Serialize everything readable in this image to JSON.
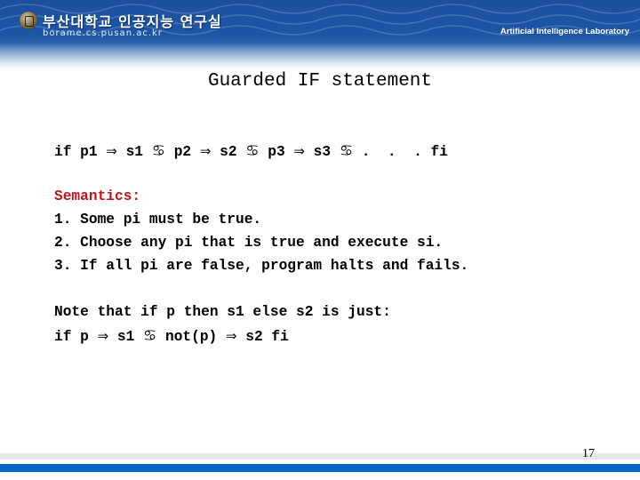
{
  "header": {
    "university_name": "부산대학교 인공지능 연구실",
    "url": "borame.cs.pusan.ac.kr",
    "lab_name": "Artificial Intelligence Laboratory",
    "logo_icon": "university-seal-icon",
    "banner_color": "#1d55a6"
  },
  "slide": {
    "title": "Guarded IF statement",
    "syntax_line": {
      "parts": [
        {
          "type": "text",
          "value": "if p1 "
        },
        {
          "type": "symbol",
          "icon": "implies-arrow-icon",
          "value": "⇒"
        },
        {
          "type": "text",
          "value": " s1 "
        },
        {
          "type": "symbol",
          "icon": "guard-separator-icon",
          "value": "♋"
        },
        {
          "type": "text",
          "value": " p2 "
        },
        {
          "type": "symbol",
          "icon": "implies-arrow-icon",
          "value": "⇒"
        },
        {
          "type": "text",
          "value": " s2 "
        },
        {
          "type": "symbol",
          "icon": "guard-separator-icon",
          "value": "♋"
        },
        {
          "type": "text",
          "value": " p3 "
        },
        {
          "type": "symbol",
          "icon": "implies-arrow-icon",
          "value": "⇒"
        },
        {
          "type": "text",
          "value": " s3 "
        },
        {
          "type": "symbol",
          "icon": "guard-separator-icon",
          "value": "♋"
        },
        {
          "type": "text",
          "value": " .  .  . fi"
        }
      ]
    },
    "semantics": {
      "heading": "Semantics:",
      "heading_color": "#c0151b",
      "items": [
        "1. Some pi must be true.",
        "2. Choose any pi that is true and execute si.",
        "3. If all pi are false, program halts and fails."
      ]
    },
    "note": {
      "line1": "Note that if p then s1 else s2 is just:",
      "line2_parts": [
        {
          "type": "text",
          "value": "if p "
        },
        {
          "type": "symbol",
          "icon": "implies-arrow-icon",
          "value": "⇒"
        },
        {
          "type": "text",
          "value": " s1 "
        },
        {
          "type": "symbol",
          "icon": "guard-separator-icon",
          "value": "♋"
        },
        {
          "type": "text",
          "value": " not(p) "
        },
        {
          "type": "symbol",
          "icon": "implies-arrow-icon",
          "value": "⇒"
        },
        {
          "type": "text",
          "value": " s2 fi"
        }
      ]
    }
  },
  "footer": {
    "page_number": "17",
    "bar_color": "#0865c6"
  }
}
